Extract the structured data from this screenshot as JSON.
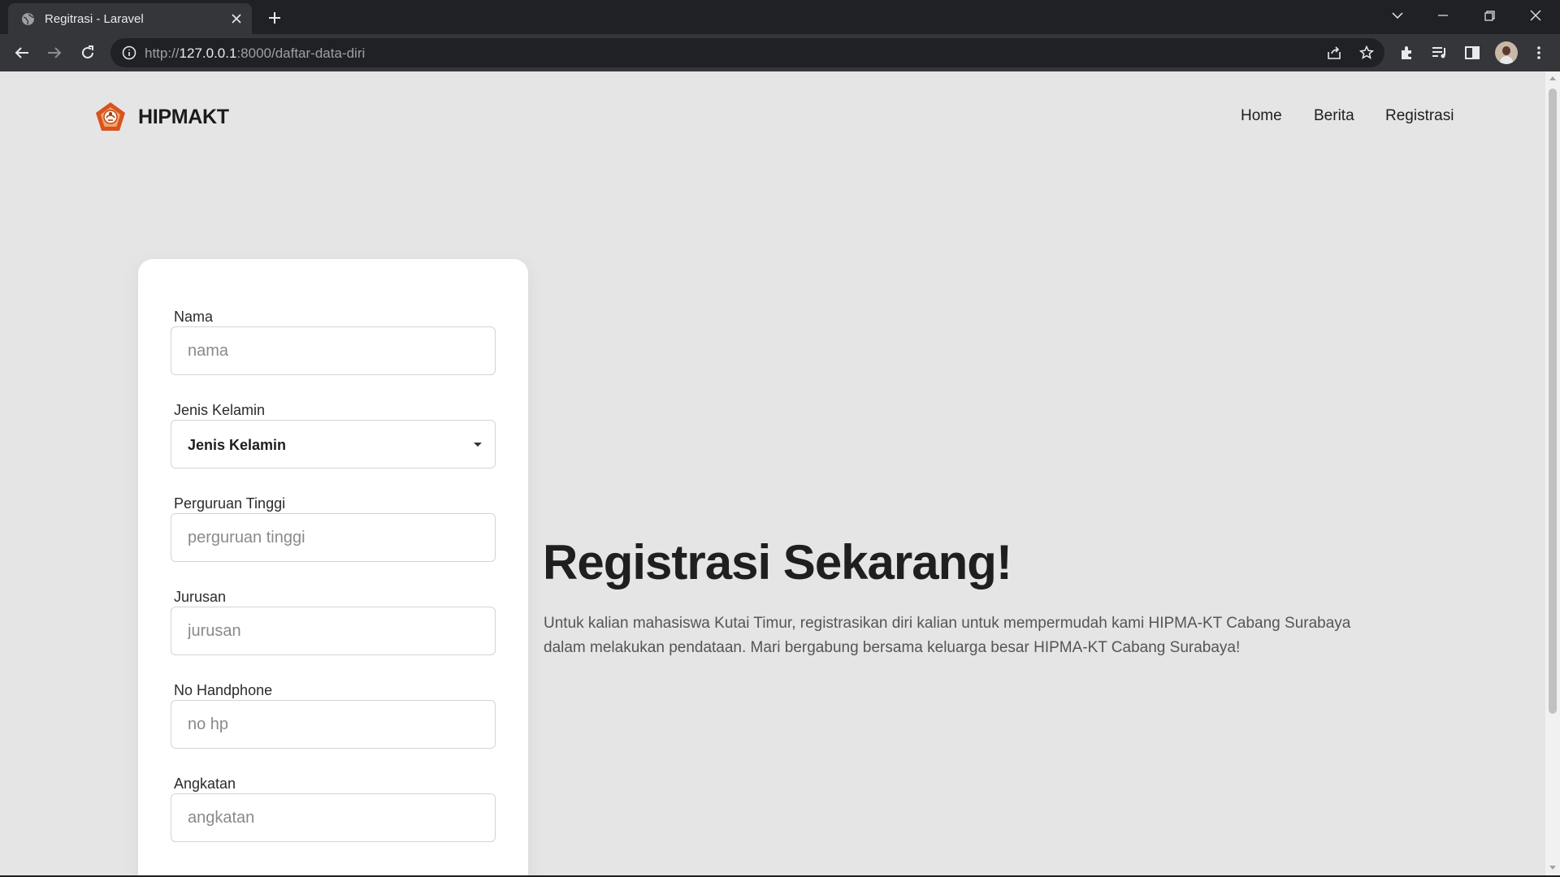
{
  "browser": {
    "tab_title": "Regitrasi - Laravel",
    "url_scheme": "http://",
    "url_host": "127.0.0.1",
    "url_rest": ":8000/daftar-data-diri"
  },
  "site": {
    "brand": "HIPMAKT",
    "nav": [
      "Home",
      "Berita",
      "Registrasi"
    ]
  },
  "form": {
    "fields": [
      {
        "label": "Nama",
        "placeholder": "nama"
      },
      {
        "label": "Jenis Kelamin",
        "value": "Jenis Kelamin"
      },
      {
        "label": "Perguruan Tinggi",
        "placeholder": "perguruan tinggi"
      },
      {
        "label": "Jurusan",
        "placeholder": "jurusan"
      },
      {
        "label": "No Handphone",
        "placeholder": "no hp"
      },
      {
        "label": "Angkatan",
        "placeholder": "angkatan"
      }
    ]
  },
  "hero": {
    "title": "Registrasi Sekarang!",
    "text": "Untuk kalian mahasiswa Kutai Timur, registrasikan diri kalian untuk mempermudah kami HIPMA-KT Cabang Surabaya dalam melakukan pendataan. Mari bergabung bersama keluarga besar HIPMA-KT Cabang Surabaya!"
  },
  "colors": {
    "chrome_dark": "#202124",
    "chrome_toolbar": "#35363a",
    "page_bg": "#e5e5e5",
    "logo_orange": "#d9531e"
  }
}
